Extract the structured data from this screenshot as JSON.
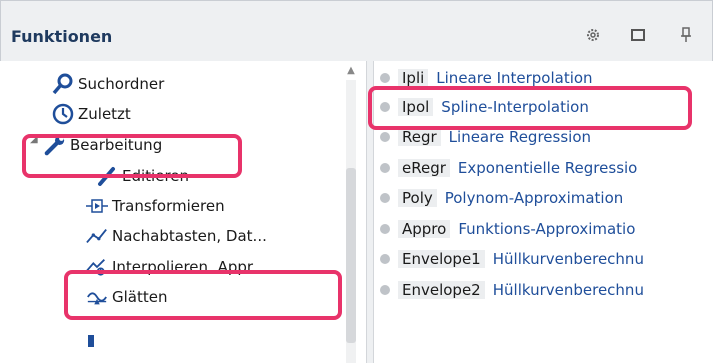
{
  "panel": {
    "title": "Funktionen",
    "icons": [
      "gear-icon",
      "restore-window-icon",
      "pin-icon"
    ]
  },
  "tree": {
    "items": [
      {
        "label": "Suchordner",
        "icon": "search-icon"
      },
      {
        "label": "Zuletzt",
        "icon": "clock-icon"
      },
      {
        "label": "Bearbeitung",
        "icon": "wrench-icon"
      },
      {
        "label": "Editieren",
        "icon": "pencil-icon"
      },
      {
        "label": "Transformieren",
        "icon": "transform-icon"
      },
      {
        "label": "Nachabtasten, Dat...",
        "icon": "resample-icon"
      },
      {
        "label": "Interpolieren, Appr..",
        "icon": "interpolate-icon"
      },
      {
        "label": "Glätten",
        "icon": "smooth-icon"
      }
    ]
  },
  "functions": {
    "rows": [
      {
        "code": "Ipli",
        "desc": "Lineare Interpolation"
      },
      {
        "code": "Ipol",
        "desc": "Spline-Interpolation"
      },
      {
        "code": "Regr",
        "desc": "Lineare Regression"
      },
      {
        "code": "eRegr",
        "desc": "Exponentielle Regressio"
      },
      {
        "code": "Poly",
        "desc": "Polynom-Approximation"
      },
      {
        "code": "Appro",
        "desc": "Funktions-Approximatio"
      },
      {
        "code": "Envelope1",
        "desc": "Hüllkurvenberechnu"
      },
      {
        "code": "Envelope2",
        "desc": "Hüllkurvenberechnu"
      }
    ]
  },
  "colors": {
    "highlight": "#e8336a",
    "selection": "#dde9f7",
    "link": "#1f4e9a"
  }
}
